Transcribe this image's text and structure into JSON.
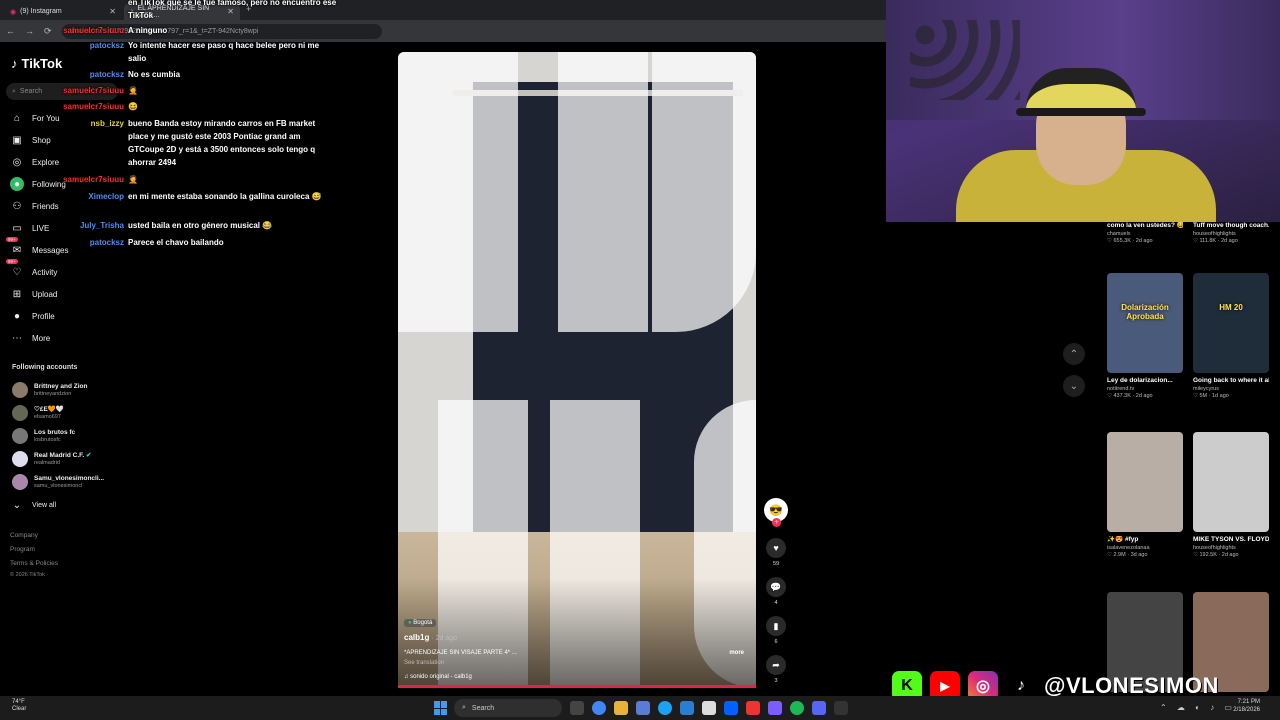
{
  "browser": {
    "tabs": [
      {
        "label": "(9) Instagram"
      },
      {
        "label": "EL APRENDIZAJE SIN VISA..."
      }
    ],
    "new_tab": "+",
    "url": "tiktok.com/...607298239884446797_r=1&_t=ZT-942Ncty8wpi"
  },
  "sidebar": {
    "brand": "TikTok",
    "search_placeholder": "Search",
    "nav": [
      {
        "label": "For You",
        "icon": "home-icon"
      },
      {
        "label": "Shop",
        "icon": "shop-icon"
      },
      {
        "label": "Explore",
        "icon": "compass-icon"
      },
      {
        "label": "Following",
        "icon": "following-icon"
      },
      {
        "label": "Friends",
        "icon": "friends-icon"
      },
      {
        "label": "LIVE",
        "icon": "live-icon"
      },
      {
        "label": "Messages",
        "icon": "messages-icon",
        "badge": "99+"
      },
      {
        "label": "Activity",
        "icon": "activity-icon",
        "badge": "99+"
      },
      {
        "label": "Upload",
        "icon": "upload-icon"
      },
      {
        "label": "Profile",
        "icon": "profile-icon"
      },
      {
        "label": "More",
        "icon": "more-icon"
      }
    ],
    "following_title": "Following accounts",
    "accounts": [
      {
        "name": "Brittney and Zion",
        "handle": "brittneyandzion"
      },
      {
        "name": "♡£E🧡🤍",
        "handle": "elsamo697"
      },
      {
        "name": "Los brutos fc",
        "handle": "losbrutosfc"
      },
      {
        "name": "Real Madrid C.F.",
        "handle": "realmadrid",
        "verified": true
      },
      {
        "name": "Samu_vlonesimoncli...",
        "handle": "samu_vlonesimoncl"
      }
    ],
    "view_all": "View all",
    "footer": [
      "Company",
      "Program",
      "Terms & Policies",
      "© 2026 TikTok"
    ]
  },
  "chat": [
    {
      "user": "",
      "text": "en TikTok que se le fue famoso, pero no encuentro ese TikTok",
      "color": "#ffffff"
    },
    {
      "user": "samuelcr7siuuu",
      "text": "A ninguno",
      "color": "#ff2c2c"
    },
    {
      "user": "patocksz",
      "text": "Yo intente hacer ese paso q hace belee pero ni me salio",
      "color": "#4a8ef5"
    },
    {
      "user": "patocksz",
      "text": "No es cumbia",
      "color": "#4a8ef5"
    },
    {
      "user": "samuelcr7siuuu",
      "text": "🤦",
      "color": "#ff2c2c"
    },
    {
      "user": "samuelcr7siuuu",
      "text": "😆",
      "color": "#ff2c2c"
    },
    {
      "user": "nsb_izzy",
      "text": "bueno Banda estoy mirando carros en FB market place y me gustó este 2003 Pontiac grand am GTCoupe 2D y está a 3500 entonces solo tengo q ahorrar 2494",
      "color": "#e8d23a"
    },
    {
      "user": "samuelcr7siuuu",
      "text": "🤦",
      "color": "#ff2c2c"
    },
    {
      "user": "Ximeclop",
      "text": "en mi mente estaba sonando la gallina curoleca 😅",
      "color": "#4a8ef5"
    },
    {
      "user": "July_Trisha",
      "text": "usted baila en otro género musical 😂",
      "color": "#4a8ef5"
    },
    {
      "user": "patocksz",
      "text": "Parece el chavo bailando",
      "color": "#4a8ef5"
    }
  ],
  "video": {
    "location": "Bogotá",
    "author": "calb1g",
    "age": "· 2d ago",
    "caption": "*APRENDIZAJE SIN VISAJE PARTE 4* ...",
    "more": "more",
    "see_translation": "See translation",
    "sound": "sonido original - calb1g",
    "progress": 1.0
  },
  "actions": [
    {
      "icon": "heart-icon",
      "count": "59"
    },
    {
      "icon": "comment-icon",
      "count": "4"
    },
    {
      "icon": "bookmark-icon",
      "count": "6"
    },
    {
      "icon": "share-icon",
      "count": "3"
    }
  ],
  "recommendations": [
    {
      "title": "como la ven ustedes? 😅😂...",
      "author": "chamuelx",
      "stats": "♡ 655.3K · 2d ago",
      "color": "#3a2a26"
    },
    {
      "title": "Tuff move though coach. 😭😭...",
      "author": "houseofhighlights",
      "stats": "♡ 111.8K · 2d ago",
      "color": "#222"
    },
    {
      "title": "Ley de dolarizacion...",
      "author": "notitrend.tv",
      "stats": "♡ 437.3K · 2d ago",
      "color": "#4a5a7a",
      "overlay": "Dolarización Aprobada"
    },
    {
      "title": "Going back to where it all...",
      "author": "mileycyrus",
      "stats": "♡ 5M · 1d ago",
      "color": "#1f2c3a",
      "overlay": "HM 20"
    },
    {
      "title": "✨😍 #fyp",
      "author": "isalavenezolanaa",
      "stats": "♡ 2.9M · 3d ago",
      "color": "#b9aea6"
    },
    {
      "title": "MIKE TYSON VS. FLOYD...",
      "author": "houseofhighlights",
      "stats": "♡ 192.5K · 2d ago",
      "color": "#ccc"
    },
    {
      "title": "",
      "author": "",
      "stats": "",
      "color": "#444"
    },
    {
      "title": "",
      "author": "",
      "stats": "",
      "color": "#8a6a5a"
    }
  ],
  "social": {
    "handle": "@VLONESIMON"
  },
  "taskbar": {
    "temp": "74°F",
    "condition": "Clear",
    "search": "Search",
    "time": "7:21 PM",
    "date": "2/18/2026"
  }
}
